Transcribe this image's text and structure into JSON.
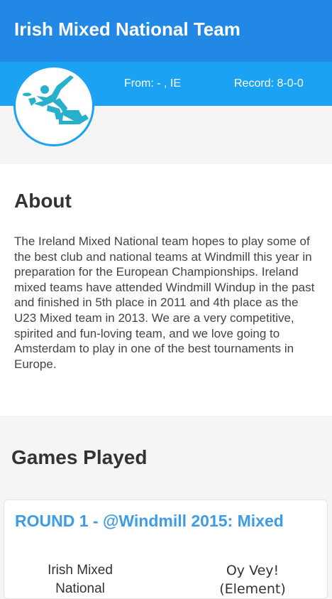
{
  "header": {
    "title": "Irish Mixed National Team"
  },
  "info": {
    "from": "From: - , IE",
    "record": "Record: 8-0-0"
  },
  "avatar": {
    "icon": "ultimate-frisbee-player-icon",
    "color": "#27b0cc"
  },
  "about": {
    "heading": "About",
    "text": "The Ireland Mixed National team hopes to play some of the best club and national teams at Windmill this year in preparation for the European Championships. Ireland mixed teams have attended Windmill Windup in the past and finished in 5th place in 2011 and 4th place as the U23 Mixed team in 2013. We are a very competitive, spirited and fun-loving team, and we love going to Amsterdam to play in one of the best tournaments in Europe."
  },
  "games": {
    "heading": "Games Played",
    "items": [
      {
        "round": "ROUND 1 - @Windmill 2015: Mixed",
        "team_left": "Irish Mixed National",
        "team_right": "Oy Vey! (Element)"
      }
    ]
  },
  "colors": {
    "header_bg": "#2288e6",
    "info_bg": "#1ca2f2",
    "accent": "#3d9ce8"
  }
}
